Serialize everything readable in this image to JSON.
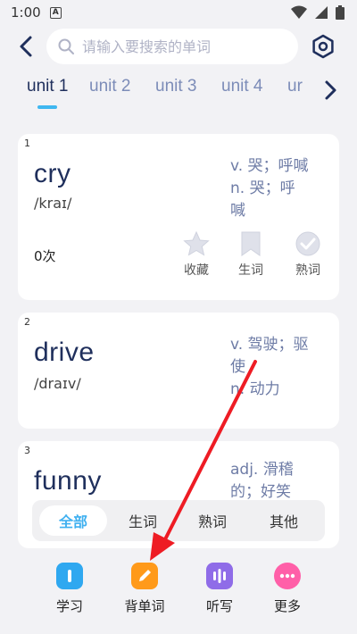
{
  "status": {
    "time": "1:00",
    "notif_badge": "A"
  },
  "search": {
    "placeholder": "请输入要搜索的单词"
  },
  "tabs": [
    {
      "label": "unit 1",
      "active": true
    },
    {
      "label": "unit 2",
      "active": false
    },
    {
      "label": "unit 3",
      "active": false
    },
    {
      "label": "unit 4",
      "active": false
    },
    {
      "label": "ur",
      "active": false
    }
  ],
  "cards": [
    {
      "num": "1",
      "word": "cry",
      "phonetic": "/kraɪ/",
      "def_lines": [
        "v. 哭；呼喊",
        "n. 哭；呼",
        "喊"
      ],
      "count": "0次",
      "actions": [
        {
          "label": "收藏",
          "icon": "star-icon"
        },
        {
          "label": "生词",
          "icon": "bookmark-icon"
        },
        {
          "label": "熟词",
          "icon": "check-circle-icon"
        }
      ]
    },
    {
      "num": "2",
      "word": "drive",
      "phonetic": "/draɪv/",
      "def_lines": [
        "v. 驾驶；驱",
        "使",
        "n. 动力"
      ]
    },
    {
      "num": "3",
      "word": "funny",
      "phonetic": "",
      "def_lines": [
        "adj. 滑稽",
        "的；好笑"
      ]
    }
  ],
  "filters": [
    {
      "label": "全部",
      "active": true
    },
    {
      "label": "生词",
      "active": false
    },
    {
      "label": "熟词",
      "active": false
    },
    {
      "label": "其他",
      "active": false
    }
  ],
  "nav": [
    {
      "label": "学习",
      "icon": "study-icon",
      "color": "#2fa8f0"
    },
    {
      "label": "背单词",
      "icon": "pencil-icon",
      "color": "#ff9a1a"
    },
    {
      "label": "听写",
      "icon": "dictation-icon",
      "color": "#8f6ce8"
    },
    {
      "label": "更多",
      "icon": "more-icon",
      "color": "#ff5fa8"
    }
  ],
  "colors": {
    "accent": "#3fb7f0",
    "arrow": "#ee1c24",
    "title": "#1f2f5c"
  }
}
